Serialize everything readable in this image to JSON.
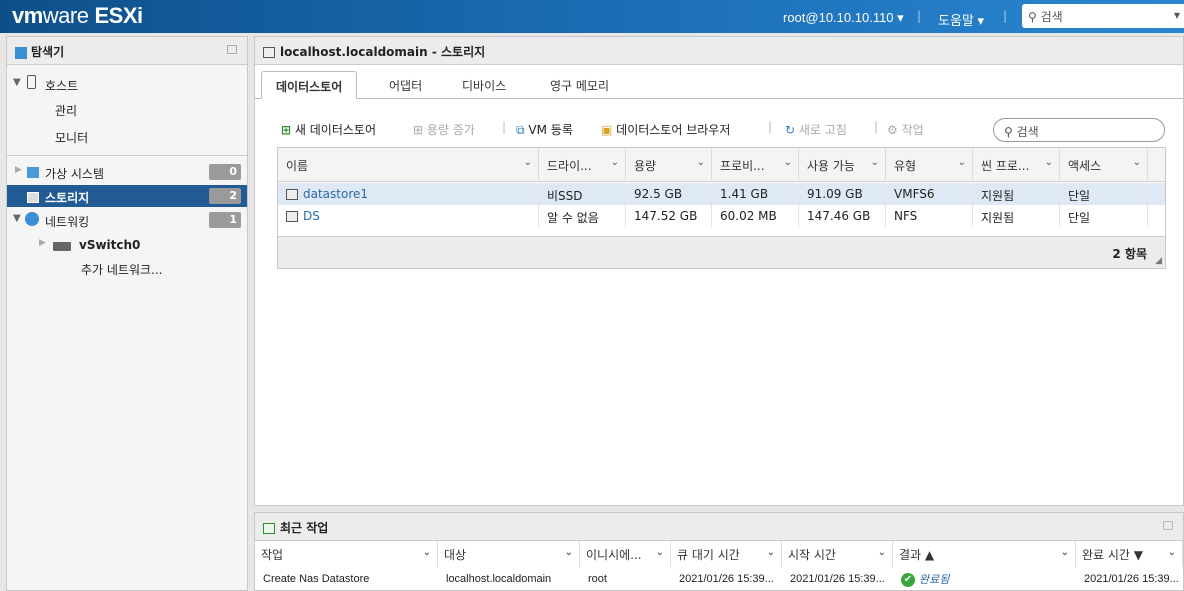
{
  "header": {
    "logo_vm": "vm",
    "logo_ware": "ware",
    "logo_product": "ESXi",
    "user": "root@10.10.10.110",
    "help": "도움말",
    "search_placeholder": "검색"
  },
  "navigator": {
    "title": "탐색기",
    "items": [
      {
        "label": "호스트"
      },
      {
        "label": "관리"
      },
      {
        "label": "모니터"
      },
      {
        "label": "가상 시스템",
        "count": "0"
      },
      {
        "label": "스토리지",
        "count": "2"
      },
      {
        "label": "네트워킹",
        "count": "1"
      },
      {
        "label": "vSwitch0"
      },
      {
        "label": "추가 네트워크..."
      }
    ]
  },
  "main": {
    "title": "localhost.localdomain - 스토리지",
    "tabs": [
      "데이터스토어",
      "어댑터",
      "디바이스",
      "영구 메모리"
    ],
    "toolbar": {
      "new_datastore": "새 데이터스토어",
      "increase_capacity": "용량 증가",
      "register_vm": "VM 등록",
      "datastore_browser": "데이터스토어 브라우저",
      "refresh": "새로 고침",
      "actions": "작업",
      "search_placeholder": "검색"
    },
    "table": {
      "columns": [
        "이름",
        "드라이...",
        "용량",
        "프로비...",
        "사용 가능",
        "유형",
        "씬 프로...",
        "액세스"
      ],
      "rows": [
        [
          "datastore1",
          "비SSD",
          "92.5 GB",
          "1.41 GB",
          "91.09 GB",
          "VMFS6",
          "지원됨",
          "단일"
        ],
        [
          "DS",
          "알 수 없음",
          "147.52 GB",
          "60.02 MB",
          "147.46 GB",
          "NFS",
          "지원됨",
          "단일"
        ]
      ],
      "footer_count": "2 항목"
    }
  },
  "recent_tasks": {
    "title": "최근 작업",
    "columns": [
      "작업",
      "대상",
      "이니시에...",
      "큐 대기 시간",
      "시작 시간",
      "결과 ▲",
      "완료 시간 ▼"
    ],
    "rows": [
      [
        "Create Nas Datastore",
        "localhost.localdomain",
        "root",
        "2021/01/26 15:39...",
        "2021/01/26 15:39...",
        "완료됨",
        "2021/01/26 15:39..."
      ]
    ]
  },
  "colors": {
    "header_blue": "#1a6db3",
    "selection_blue": "#225b94",
    "success_green": "#3aa53a"
  }
}
